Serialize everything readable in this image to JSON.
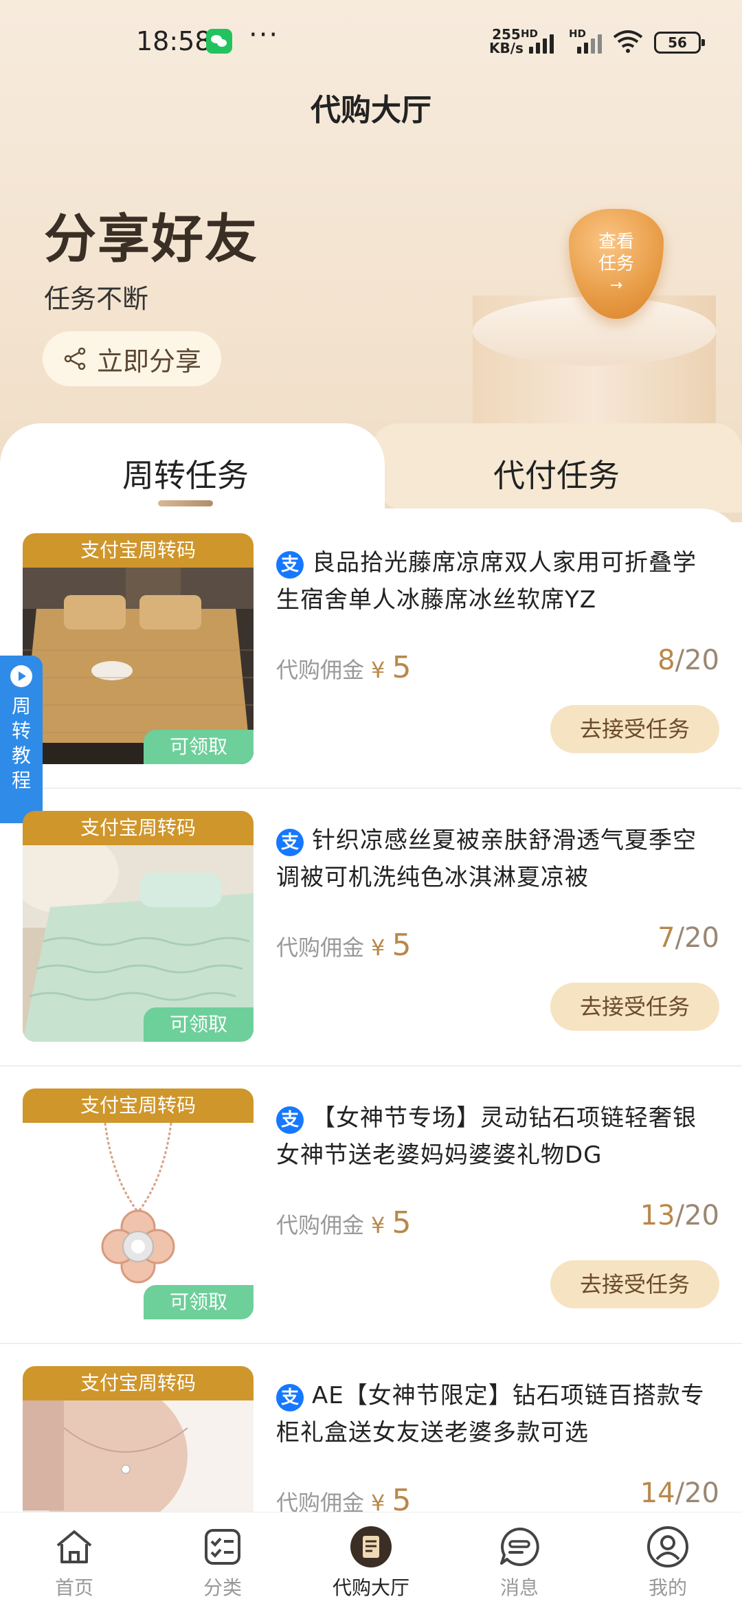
{
  "status_bar": {
    "time": "18:58",
    "dots": "···",
    "net_speed_value": "255",
    "net_speed_unit": "KB/s",
    "hd1": "HD",
    "hd2": "HD",
    "battery": "56"
  },
  "header": {
    "title": "代购大厅"
  },
  "hero": {
    "title": "分享好友",
    "subtitle": "任务不断",
    "share_label": "立即分享",
    "badge_line1": "查看",
    "badge_line2": "任务",
    "badge_arrow": "→"
  },
  "tabs": [
    {
      "label": "周转任务",
      "active": true
    },
    {
      "label": "代付任务",
      "active": false
    }
  ],
  "side_tab": {
    "chars": [
      "周",
      "转",
      "教",
      "程"
    ]
  },
  "tasks": [
    {
      "badge_top": "支付宝周转码",
      "badge_claim": "可领取",
      "platform_icon": "支",
      "title": "良品拾光藤席凉席双人家用可折叠学生宿舍单人冰藤席冰丝软席YZ",
      "commission_label": "代购佣金",
      "commission_symbol": "¥",
      "commission_value": "5",
      "progress_done": "8",
      "progress_total": "/20",
      "button": "去接受任务"
    },
    {
      "badge_top": "支付宝周转码",
      "badge_claim": "可领取",
      "platform_icon": "支",
      "title": "针织凉感丝夏被亲肤舒滑透气夏季空调被可机洗纯色冰淇淋夏凉被",
      "commission_label": "代购佣金",
      "commission_symbol": "¥",
      "commission_value": "5",
      "progress_done": "7",
      "progress_total": "/20",
      "button": "去接受任务"
    },
    {
      "badge_top": "支付宝周转码",
      "badge_claim": "可领取",
      "platform_icon": "支",
      "title": "【女神节专场】灵动钻石项链轻奢银女神节送老婆妈妈婆婆礼物DG",
      "commission_label": "代购佣金",
      "commission_symbol": "¥",
      "commission_value": "5",
      "progress_done": "13",
      "progress_total": "/20",
      "button": "去接受任务"
    },
    {
      "badge_top": "支付宝周转码",
      "badge_claim": "",
      "platform_icon": "支",
      "title": "AE【女神节限定】钻石项链百搭款专柜礼盒送女友送老婆多款可选",
      "commission_label": "代购佣金",
      "commission_symbol": "¥",
      "commission_value": "5",
      "progress_done": "14",
      "progress_total": "/20",
      "button": ""
    }
  ],
  "bottom_nav": [
    {
      "label": "首页",
      "icon": "home-icon"
    },
    {
      "label": "分类",
      "icon": "category-icon"
    },
    {
      "label": "代购大厅",
      "icon": "hall-icon",
      "active": true
    },
    {
      "label": "消息",
      "icon": "message-icon"
    },
    {
      "label": "我的",
      "icon": "profile-icon"
    }
  ],
  "colors": {
    "accent": "#b9884a",
    "badge_top": "#cf962b",
    "badge_claim": "#6dcf9a",
    "side_tab": "#2f8be8",
    "alipay": "#1678ff"
  }
}
